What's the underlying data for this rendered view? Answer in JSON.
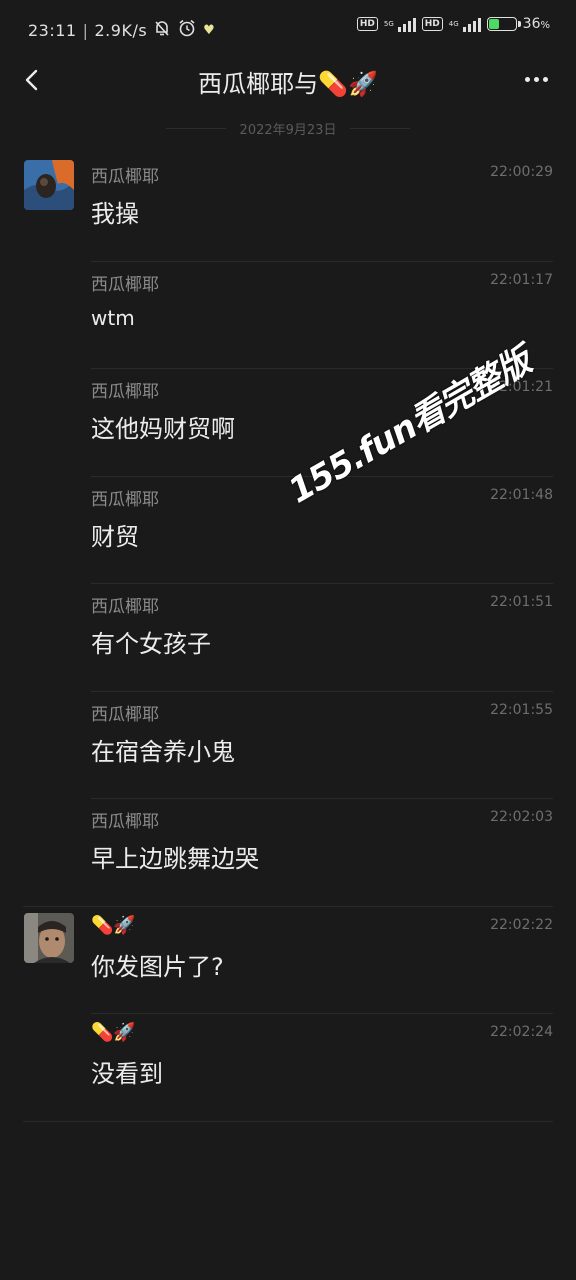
{
  "status": {
    "time": "23:11",
    "speed": "2.9K/s",
    "battery_pct": "36",
    "battery_level": 0.36,
    "hd_label": "HD",
    "net1": "5G",
    "net2": "4G",
    "accent_battery": "#4cd964"
  },
  "header": {
    "title": "西瓜椰耶与💊🚀"
  },
  "date_label": "2022年9月23日",
  "messages": [
    {
      "sender": "西瓜椰耶",
      "time": "22:00:29",
      "text": "我操"
    },
    {
      "sender": "西瓜椰耶",
      "time": "22:01:17",
      "text": "wtm"
    },
    {
      "sender": "西瓜椰耶",
      "time": "22:01:21",
      "text": "这他妈财贸啊"
    },
    {
      "sender": "西瓜椰耶",
      "time": "22:01:48",
      "text": "财贸"
    },
    {
      "sender": "西瓜椰耶",
      "time": "22:01:51",
      "text": "有个女孩子"
    },
    {
      "sender": "西瓜椰耶",
      "time": "22:01:55",
      "text": "在宿舍养小鬼"
    },
    {
      "sender": "西瓜椰耶",
      "time": "22:02:03",
      "text": "早上边跳舞边哭"
    },
    {
      "sender": "💊🚀",
      "time": "22:02:22",
      "text": "你发图片了?"
    },
    {
      "sender": "💊🚀",
      "time": "22:02:24",
      "text": "没看到"
    }
  ],
  "watermark": "155.fun看完整版"
}
